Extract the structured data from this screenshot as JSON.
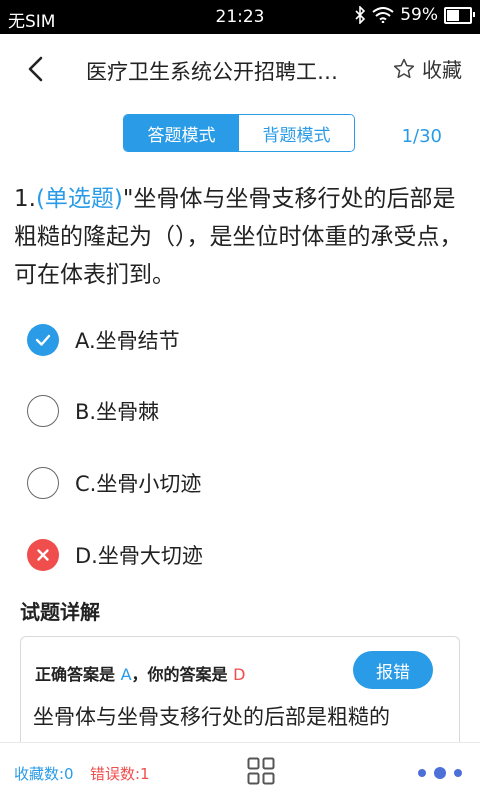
{
  "status_bar": {
    "carrier": "无SIM",
    "time": "21:23",
    "battery": "59%"
  },
  "nav": {
    "title": "医疗卫生系统公开招聘工…",
    "favorite_label": "收藏"
  },
  "mode_toggle": {
    "answer_mode": "答题模式",
    "recite_mode": "背题模式",
    "active": "answer_mode"
  },
  "progress": "1/30",
  "question": {
    "number": "1.",
    "type": "(单选题)",
    "text": "\"坐骨体与坐骨支移行处的后部是粗糙的隆起为（），是坐位时体重的承受点，可在体表扪到。"
  },
  "options": [
    {
      "label": "A.坐骨结节",
      "state": "correct"
    },
    {
      "label": "B.坐骨棘",
      "state": "empty"
    },
    {
      "label": "C.坐骨小切迹",
      "state": "empty"
    },
    {
      "label": "D.坐骨大切迹",
      "state": "wrong"
    }
  ],
  "detail": {
    "title": "试题详解",
    "correct_prefix": "正确答案是 ",
    "correct_answer": "A",
    "user_prefix": "，你的答案是 ",
    "user_answer": "D",
    "report_label": "报错",
    "explanation": "坐骨体与坐骨支移行处的后部是粗糙的"
  },
  "bottom": {
    "fav_count": "收藏数:0",
    "error_count": "错误数:1"
  },
  "colors": {
    "accent": "#2a9be6",
    "error": "#f04d4d"
  }
}
